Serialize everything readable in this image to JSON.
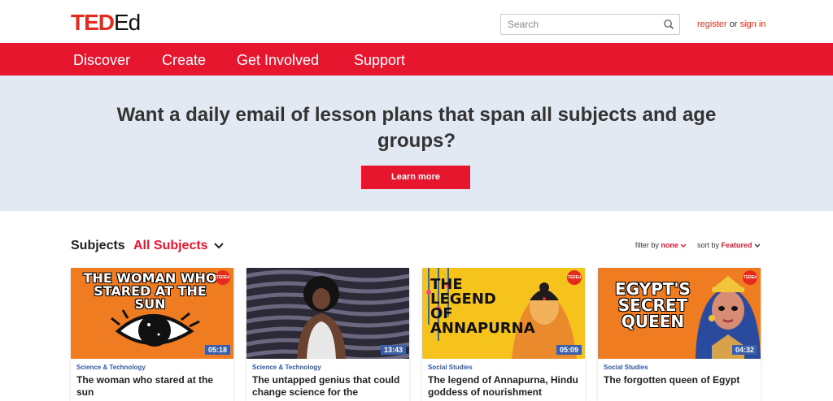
{
  "header": {
    "logo_ted": "TED",
    "logo_ed": "Ed",
    "search_placeholder": "Search",
    "register_label": "register",
    "or_label": "or",
    "signin_label": "sign in"
  },
  "nav": {
    "items": [
      {
        "label": "Discover"
      },
      {
        "label": "Create"
      },
      {
        "label": "Get Involved"
      },
      {
        "label": "Support"
      }
    ]
  },
  "banner": {
    "headline": "Want a daily email of lesson plans that span all subjects and age groups?",
    "button_label": "Learn more"
  },
  "subjects": {
    "label": "Subjects",
    "selected": "All Subjects",
    "filter_label": "filter by",
    "filter_value": "none",
    "sort_label": "sort by",
    "sort_value": "Featured"
  },
  "cards": [
    {
      "category": "Science & Technology",
      "title": "The woman who stared at the sun",
      "duration": "05:18",
      "thumb_text": "THE WOMAN WHO STARED AT THE SUN",
      "badge": "TEDEd"
    },
    {
      "category": "Science & Technology",
      "title": "The untapped genius that could change science for the",
      "duration": "13:43",
      "thumb_text": "",
      "badge": ""
    },
    {
      "category": "Social Studies",
      "title": "The legend of Annapurna, Hindu goddess of nourishment",
      "duration": "05:09",
      "thumb_text": "THE LEGEND OF ANNAPURNA",
      "badge": "TEDEd"
    },
    {
      "category": "Social Studies",
      "title": "The forgotten queen of Egypt",
      "duration": "04:32",
      "thumb_text": "EGYPT'S SECRET QUEEN",
      "badge": "TEDEd"
    }
  ],
  "colors": {
    "brand_red": "#e6162f",
    "banner_bg": "#e3e9f2",
    "category_blue": "#2e5aa8",
    "duration_bg": "#3b5ea8"
  }
}
